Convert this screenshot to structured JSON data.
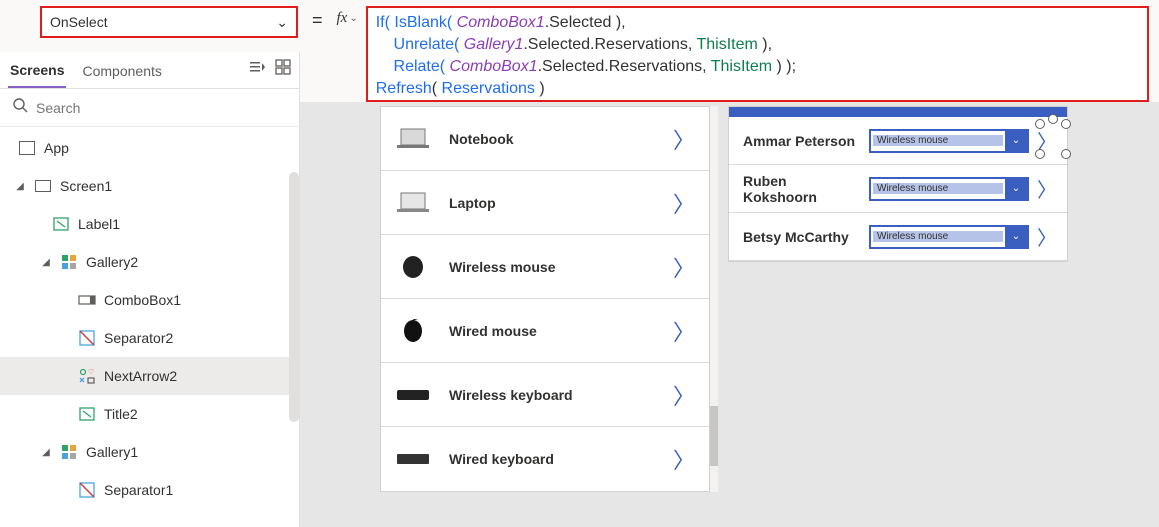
{
  "property_dropdown": {
    "value": "OnSelect"
  },
  "formula": {
    "line1_pre": "If( IsBlank( ",
    "line1_obj": "ComboBox1",
    "line1_post": ".Selected ),",
    "line2_pre": "    Unrelate( ",
    "line2_obj": "Gallery1",
    "line2_mid": ".Selected.Reservations, ",
    "line2_kw": "ThisItem",
    "line2_post": " ),",
    "line3_pre": "    Relate( ",
    "line3_obj": "ComboBox1",
    "line3_mid": ".Selected.Reservations, ",
    "line3_kw": "ThisItem",
    "line3_post": " ) );",
    "line4_fn": "Refresh",
    "line4_mid": "( ",
    "line4_id": "Reservations",
    "line4_post": " )"
  },
  "tabs": {
    "screens": "Screens",
    "components": "Components"
  },
  "search": {
    "placeholder": "Search"
  },
  "tree": {
    "app": "App",
    "screen1": "Screen1",
    "label1": "Label1",
    "gallery2": "Gallery2",
    "combobox1": "ComboBox1",
    "separator2": "Separator2",
    "nextarrow2": "NextArrow2",
    "title2": "Title2",
    "gallery1": "Gallery1",
    "separator1": "Separator1"
  },
  "products": [
    {
      "name": "Notebook"
    },
    {
      "name": "Laptop"
    },
    {
      "name": "Wireless mouse"
    },
    {
      "name": "Wired mouse"
    },
    {
      "name": "Wireless keyboard"
    },
    {
      "name": "Wired keyboard"
    }
  ],
  "reservations": [
    {
      "person": "Ammar Peterson",
      "combo": "Wireless mouse"
    },
    {
      "person": "Ruben Kokshoorn",
      "combo": "Wireless mouse"
    },
    {
      "person": "Betsy McCarthy",
      "combo": "Wireless mouse"
    }
  ]
}
